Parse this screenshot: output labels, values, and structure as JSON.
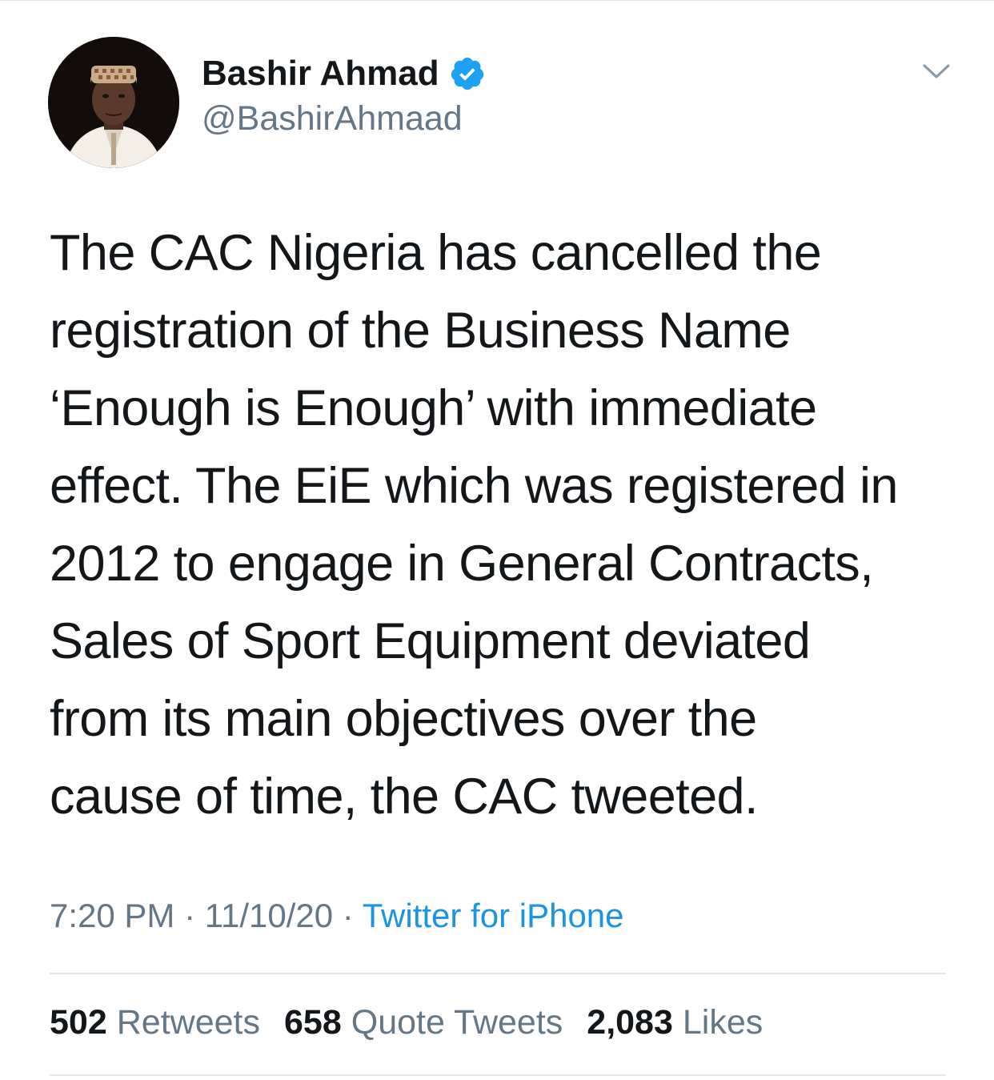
{
  "author": {
    "display_name": "Bashir Ahmad",
    "handle": "@BashirAhmaad",
    "verified": true,
    "avatar_icon": "profile-photo"
  },
  "menu_icon": "chevron-down-icon",
  "tweet": {
    "text": "The CAC Nigeria has cancelled the\nregistration of the Business Name\n‘Enough is Enough’ with immediate\neffect. The EiE which was registered in\n2012 to engage in General Contracts,\nSales of Sport Equipment deviated\nfrom its main objectives over the\ncause of time, the CAC tweeted."
  },
  "meta": {
    "time": "7:20 PM",
    "sep1": " · ",
    "date": "11/10/20",
    "sep2": " · ",
    "source": "Twitter for iPhone"
  },
  "stats": {
    "retweets_count": "502",
    "retweets_label": "Retweets",
    "quotes_count": "658",
    "quotes_label": "Quote Tweets",
    "likes_count": "2,083",
    "likes_label": "Likes"
  },
  "colors": {
    "text": "#14171a",
    "secondary": "#657786",
    "link": "#1b95e0",
    "verified": "#1da1f2",
    "divider": "#e1e8ed"
  }
}
